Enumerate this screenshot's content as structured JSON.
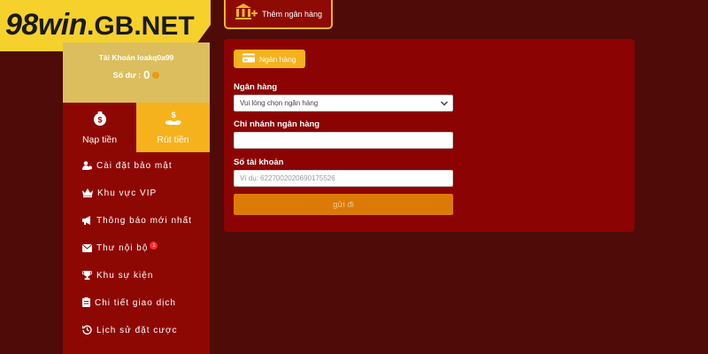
{
  "logo": {
    "brand": "98win",
    "domain": ".GB.NET"
  },
  "top_tab": {
    "label": "Thêm ngân hàng"
  },
  "account": {
    "account_text": "Tài Khoản loakq0a99",
    "balance_label": "Số dư :",
    "balance_value": "0"
  },
  "actions": {
    "deposit": "Nạp tiền",
    "withdraw": "Rút tiền"
  },
  "menu": {
    "items": [
      {
        "label": "Cài đặt bảo mật",
        "icon": "user-gear-icon"
      },
      {
        "label": "Khu vực VIP",
        "icon": "crown-icon"
      },
      {
        "label": "Thông báo mới nhất",
        "icon": "megaphone-icon"
      },
      {
        "label": "Thư nội bộ",
        "icon": "envelope-icon",
        "badge": "1"
      },
      {
        "label": "Khu sự kiện",
        "icon": "trophy-icon"
      },
      {
        "label": "Chi tiết giao dịch",
        "icon": "clipboard-icon"
      },
      {
        "label": "Lịch sử đặt cược",
        "icon": "history-icon"
      }
    ]
  },
  "form": {
    "tab_label": "Ngân hàng",
    "bank_label": "Ngân hàng",
    "bank_select_value": "Vui lòng chọn ngân hàng",
    "branch_label": "Chi nhánh ngân hàng",
    "branch_value": "",
    "account_number_label": "Số tài khoản",
    "account_number_placeholder": "Ví dụ: 6227002020690175526",
    "submit_label": "gửi đi"
  },
  "colors": {
    "background": "#4e0b08",
    "panel": "#8b0303",
    "accent": "#f6b21d",
    "gold_panel": "#dcbe5e",
    "submit": "#dc7a08",
    "logo_bg": "#f6d12c"
  }
}
